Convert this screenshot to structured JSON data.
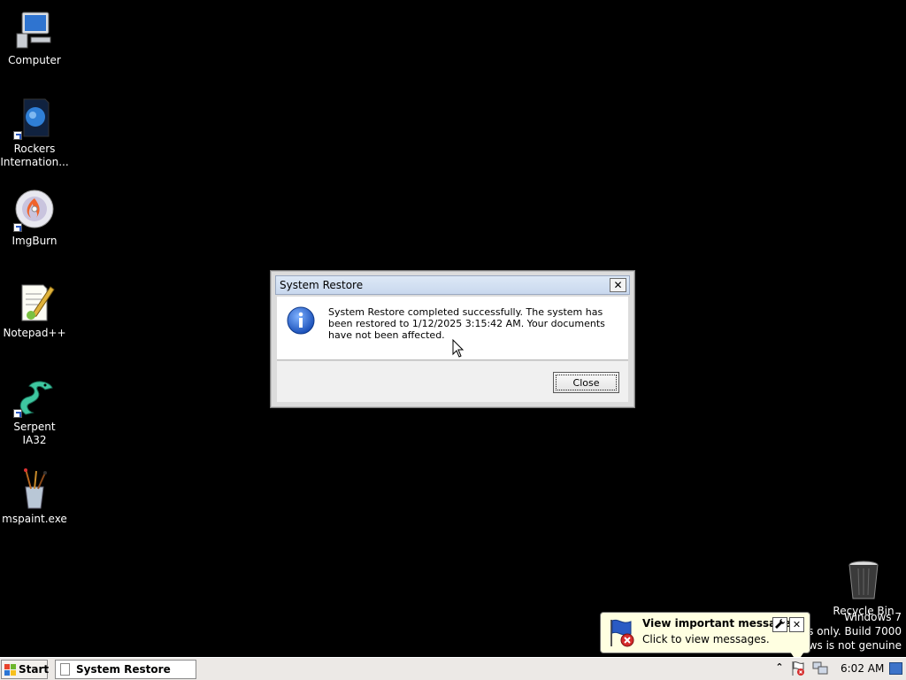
{
  "desktop": {
    "icons": [
      {
        "label": "Computer",
        "icon": "computer-icon"
      },
      {
        "label": "Rockers Internation...",
        "icon": "rockers-app-icon"
      },
      {
        "label": "ImgBurn",
        "icon": "imgburn-disc-icon"
      },
      {
        "label": "Notepad++",
        "icon": "notepad-plus-plus-icon"
      },
      {
        "label": "Serpent IA32",
        "icon": "serpent-icon"
      },
      {
        "label": "mspaint.exe",
        "icon": "mspaint-icon"
      },
      {
        "label": "Recycle Bin",
        "icon": "recycle-bin-icon"
      }
    ],
    "watermark": {
      "line1": "Windows 7",
      "line2": "ses only. Build 7000",
      "line3": "lows is not genuine"
    }
  },
  "dialog": {
    "title": "System Restore",
    "close_glyph": "✕",
    "message": "System Restore completed successfully. The system has been restored to 1/12/2025 3:15:42 AM. Your documents have not been affected.",
    "close_button": "Close",
    "icon": "info-icon"
  },
  "balloon": {
    "title": "View important messages",
    "subtitle": "Click to view messages.",
    "options_glyph": "🔧",
    "close_glyph": "✕",
    "icon": "action-center-flag-icon"
  },
  "taskbar": {
    "start_label": "Start",
    "window_button": "System Restore",
    "tray_expand_glyph": "⌃",
    "clock": "6:02 AM"
  },
  "colors": {
    "desktop_bg": "#000000",
    "titlebar": "#c9d8ee",
    "balloon_bg": "#ffffe1",
    "taskbar_bg": "#ece9e6"
  }
}
